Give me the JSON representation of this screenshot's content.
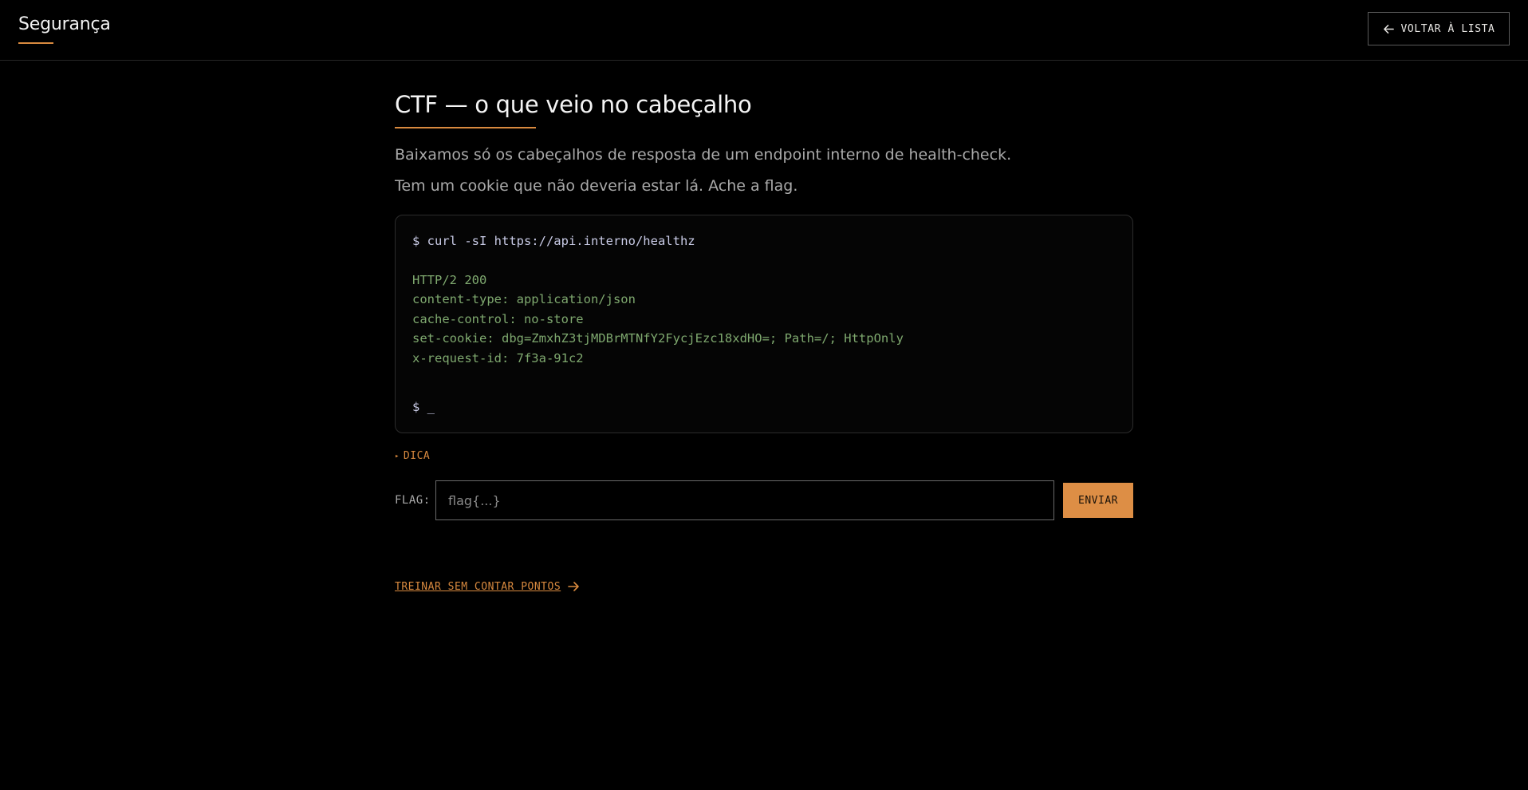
{
  "header": {
    "brand": "Segurança",
    "back_label": "VOLTAR À LISTA"
  },
  "challenge": {
    "title": "CTF — o que veio no cabeçalho",
    "desc_line1": "Baixamos só os cabeçalhos de resposta de um endpoint interno de health-check.",
    "desc_line2": "Tem um cookie que não deveria estar lá. Ache a flag."
  },
  "terminal": {
    "command": "$ curl -sI https://api.interno/healthz",
    "output": [
      "HTTP/2 200",
      "content-type: application/json",
      "cache-control: no-store",
      "set-cookie: dbg=ZmxhZ3tjMDBrMTNfY2FycjEzc18xdHO=; Path=/; HttpOnly",
      "x-request-id: 7f3a-91c2"
    ],
    "prompt": "$ _"
  },
  "hint": {
    "arrow": "▸",
    "label": "DICA"
  },
  "flag_form": {
    "label": "FLAG:",
    "placeholder": "flag{...}",
    "value": "",
    "submit_label": "ENVIAR"
  },
  "practice": {
    "label": "TREINAR SEM CONTAR PONTOS"
  },
  "colors": {
    "accent": "#d98a3f",
    "button": "#dd8e45",
    "terminal_output": "#7fa96f",
    "terminal_command": "#c9cbe6"
  }
}
